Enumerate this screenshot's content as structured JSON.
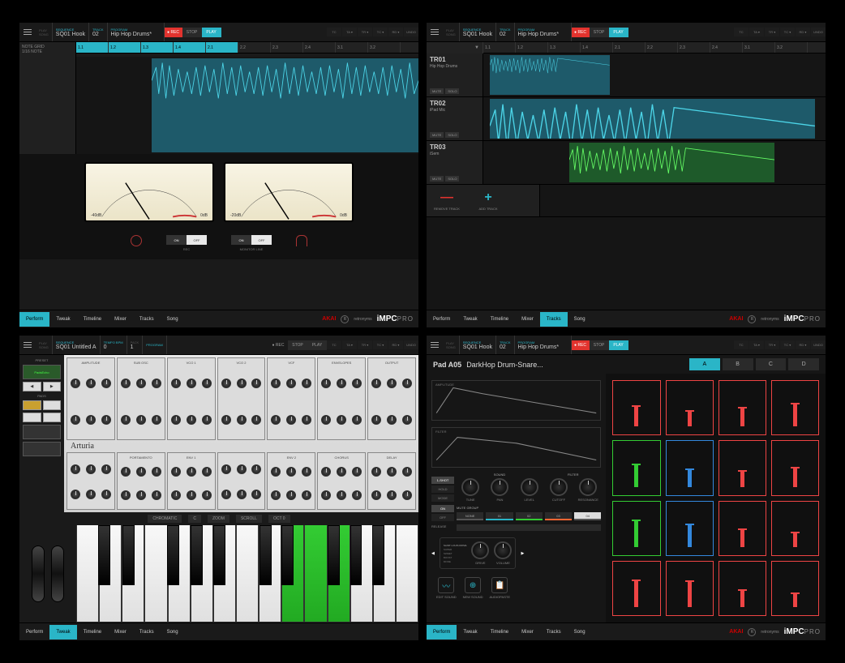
{
  "common": {
    "play_song_label1": "PLAY",
    "play_song_label2": "SONG",
    "seq_label": "SEQUENCE",
    "seq_val": "SQ01 Hook",
    "track_label": "TRACK",
    "track_val": "02",
    "program_label": "PROGRAM",
    "program_val": "Hip Hop Drums*",
    "rec": "● REC",
    "stop": "STOP",
    "play": "PLAY",
    "mini": [
      "TC",
      "TA ▾",
      "TR ▾",
      "TC ▾",
      "RD ▾",
      "UNDO"
    ],
    "akai": "AKAI",
    "retronyms": "retronyms",
    "impc": "iMPC",
    "pro": "PRO"
  },
  "screen1": {
    "side1": "NOTE GRID",
    "side2": "1/16 NOTE",
    "ruler": [
      "1.1",
      "1.2",
      "1.3",
      "1.4",
      "2.1",
      "2.2",
      "2.3",
      "2.4",
      "3.1",
      "3.2"
    ],
    "meter_l_left": "-40dB",
    "meter_l_right": "0dB",
    "meter_r_left": "-20dB",
    "meter_r_right": "0dB",
    "switch_on": "ON",
    "switch_off": "OFF",
    "rec_lbl": "REC",
    "monitor_lbl": "MONITOR LINE",
    "tabs": [
      "Perform",
      "Tweak",
      "Timeline",
      "Mixer",
      "Tracks",
      "Song"
    ],
    "active_tab": 0
  },
  "screen2": {
    "ruler": [
      "1.1",
      "1.2",
      "1.3",
      "1.4",
      "2.1",
      "2.2",
      "2.3",
      "2.4",
      "3.1",
      "3.2"
    ],
    "tracks": [
      {
        "id": "TR01",
        "name": "Hip Hop Drums",
        "mute": "MUTE",
        "solo": "SOLO"
      },
      {
        "id": "TR02",
        "name": "iPad Mic",
        "mute": "MUTE",
        "solo": "SOLO"
      },
      {
        "id": "TR03",
        "name": "iSem",
        "mute": "MUTE",
        "solo": "SOLO"
      }
    ],
    "remove": "REMOVE TRACK",
    "add": "ADD TRACK",
    "tabs": [
      "Perform",
      "Tweak",
      "Timeline",
      "Mixer",
      "Tracks",
      "Song"
    ],
    "active_tab": 4
  },
  "screen3": {
    "seq_val": "SQ01 Untitled A",
    "bpm_label": "TEMPO BPM",
    "bpm_val": "0",
    "pack": "PACK",
    "pack_val": "1",
    "prog": "PROGRAM",
    "side_preset": "PRESET",
    "side_patch": "PadsEcho",
    "side_pads": "PADS",
    "side_btns": [
      "◀",
      "▶"
    ],
    "sections_top": [
      "AMPLITUDE",
      "SUB OSC",
      "VCO 1",
      "VCO 2",
      "VCF",
      "ENVELOPES",
      "OUTPUT"
    ],
    "sections_bot": [
      "",
      "PORTAMENTO",
      "ENV 1",
      "",
      "ENV 2",
      "CHORUS",
      "DELAY"
    ],
    "arturia": "Arturia",
    "tools": [
      "CHROMATIC",
      "C",
      "ZOOM",
      "SCROLL",
      "OCT 0"
    ],
    "tabs": [
      "Perform",
      "Tweak",
      "Timeline",
      "Mixer",
      "Tracks",
      "Song"
    ],
    "active_tab": 1
  },
  "screen4": {
    "pad_title_pre": "Pad A05",
    "pad_title": "DarkHop Drum-Snare...",
    "banks": [
      "A",
      "B",
      "C",
      "D"
    ],
    "env1": "AMPLITUDE",
    "env2": "FILTER",
    "side1": [
      "1-SHOT",
      "HOLD",
      "MODE"
    ],
    "side2": [
      "ON",
      "OFF"
    ],
    "heads": [
      "SOUND",
      "",
      "",
      "FILTER"
    ],
    "knobs": [
      "TUNE",
      "PAN",
      "LEVEL",
      "CUTOFF",
      "RESONANCE"
    ],
    "mute_grp": "MUTE GROUP",
    "mutes": [
      "NONE",
      "01",
      "02",
      "03",
      "04"
    ],
    "release": "RELEASE",
    "drive_grp_label": "SAINT LOUIS DRIVE",
    "drive_side": [
      "SUPER",
      "SWEET",
      "BOOST",
      "MODE"
    ],
    "drive": [
      "DRIVE",
      "VOLUME"
    ],
    "tools": [
      "EDIT SOUND",
      "NEW SOUND",
      "AUDIOPASTE"
    ],
    "tabs": [
      "Perform",
      "Tweak",
      "Timeline",
      "Mixer",
      "Tracks",
      "Song"
    ],
    "active_tab": 0
  }
}
